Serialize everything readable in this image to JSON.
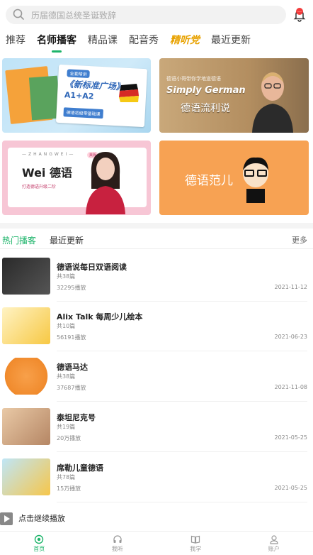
{
  "search": {
    "placeholder": "历届德国总统圣诞致辞"
  },
  "notifications": {
    "badge": "…"
  },
  "tabs": [
    {
      "label": "推荐"
    },
    {
      "label": "名师播客"
    },
    {
      "label": "精品课"
    },
    {
      "label": "配音秀"
    },
    {
      "label": "精听党"
    },
    {
      "label": "最近更新"
    }
  ],
  "banners": {
    "b1": {
      "tag": "全套精讲",
      "title": "《新标准广场》",
      "sub": "A1+A2",
      "foot": "德语初级零基础课"
    },
    "b2": {
      "line1": "德语小哥带你学地道德语",
      "title": "Simply German",
      "sub": "德语流利说"
    },
    "b3": {
      "zw": "—ZHANGWEI—",
      "wei": "Wei 德语",
      "plan": "打造德语升级二阶",
      "badge": "美版"
    },
    "b4": {
      "text": "德语范儿"
    }
  },
  "section": {
    "tab_hot": "热门播客",
    "tab_recent": "最近更新",
    "more": "更多"
  },
  "podcasts": [
    {
      "title": "德语说每日双语阅读",
      "count": "共38篇",
      "plays": "32295播放",
      "date": "2021-11-12"
    },
    {
      "title": "Alix Talk 每周少儿绘本",
      "count": "共10篇",
      "plays": "56191播放",
      "date": "2021-06-23"
    },
    {
      "title": "德语马达",
      "count": "共38篇",
      "plays": "37687播放",
      "date": "2021-11-08"
    },
    {
      "title": "泰坦尼克号",
      "count": "共19篇",
      "plays": "20万播放",
      "date": "2021-05-25"
    },
    {
      "title": "席勒儿童德语",
      "count": "共78篇",
      "plays": "15万播放",
      "date": "2021-05-25"
    }
  ],
  "continue_label": "点击继续播放",
  "bottom_nav": [
    {
      "label": "首页"
    },
    {
      "label": "我听"
    },
    {
      "label": "我学"
    },
    {
      "label": "账户"
    }
  ],
  "colors": {
    "accent": "#1db46a",
    "badge": "#f23c3c"
  }
}
